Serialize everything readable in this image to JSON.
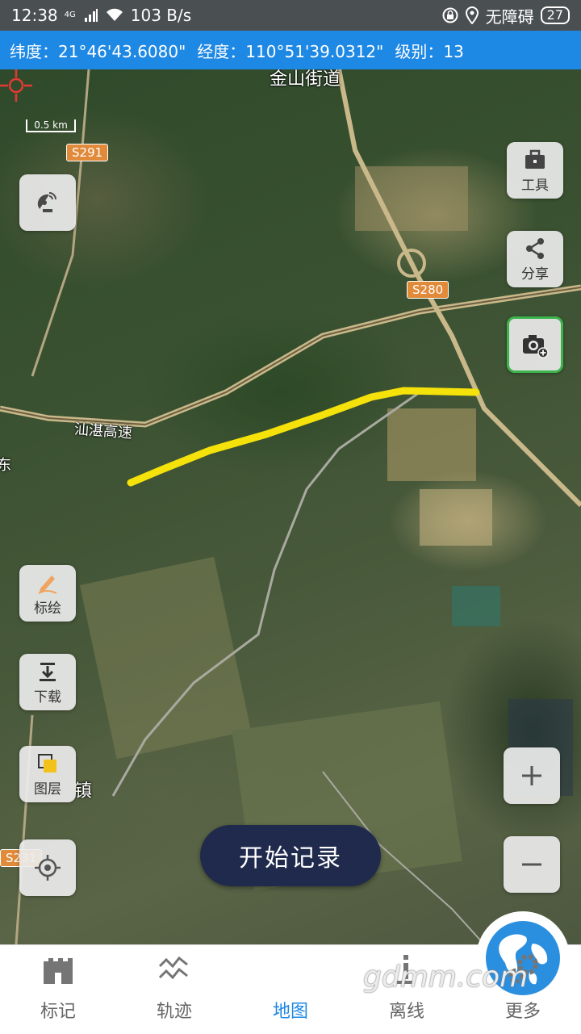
{
  "status_bar": {
    "time": "12:38",
    "network": "4G",
    "speed": "103 B/s",
    "accessibility": "无障碍",
    "battery": "27"
  },
  "coord_bar": {
    "lat": "纬度：21°46'43.6080\"",
    "lon": "经度：110°51'39.0312\"",
    "level": "级别：13"
  },
  "map": {
    "labels": {
      "jinshan": "金山街道",
      "expressway": "汕湛高速",
      "town": "镇",
      "left_edge": "东"
    },
    "roads": {
      "s291": "S291",
      "s280": "S280",
      "s231": "S231"
    },
    "scale": "0.5 km",
    "track_color": "#f5e20a"
  },
  "right_tools": {
    "tools": "工具",
    "share": "分享"
  },
  "left_tools": {
    "draw": "标绘",
    "download": "下载",
    "layers": "图层"
  },
  "record_button": "开始记录",
  "bottom_nav": [
    {
      "label": "标记",
      "icon": "castle-icon"
    },
    {
      "label": "轨迹",
      "icon": "track-icon"
    },
    {
      "label": "地图",
      "icon": "globe-icon"
    },
    {
      "label": "离线",
      "icon": "offline-icon"
    },
    {
      "label": "更多",
      "icon": "gear-icon"
    }
  ],
  "watermark": "gdmm.com",
  "colors": {
    "accent": "#1e88e5",
    "record_bg": "#1f2a4d",
    "active_border": "#3cb44b"
  }
}
